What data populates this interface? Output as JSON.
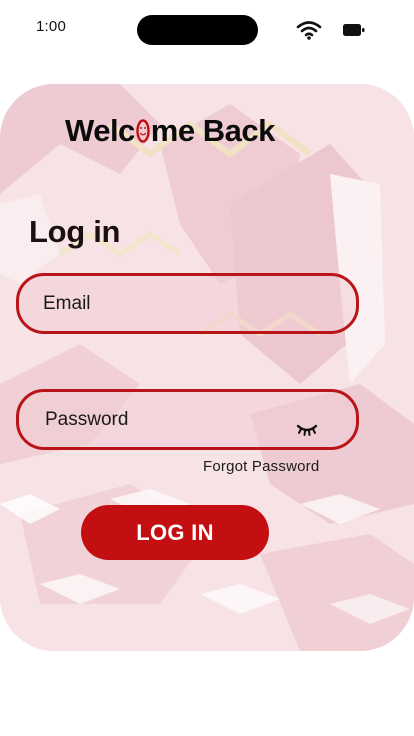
{
  "status_bar": {
    "time": "1:00",
    "icons": [
      "wifi-icon",
      "battery-icon"
    ]
  },
  "header": {
    "title_before": "Welc",
    "title_after": "me Back",
    "title_icon": "smiley-face-icon"
  },
  "login": {
    "heading": "Log in",
    "email_placeholder": "Email",
    "password_placeholder": "Password",
    "password_toggle_icon": "eye-closed-icon",
    "forgot_password": "Forgot Password",
    "submit_label": "LOG IN"
  },
  "colors": {
    "accent": "#c30f12",
    "field_border": "#b91518",
    "card_background": "#f8e5e9",
    "text": "#0b0b0b"
  }
}
